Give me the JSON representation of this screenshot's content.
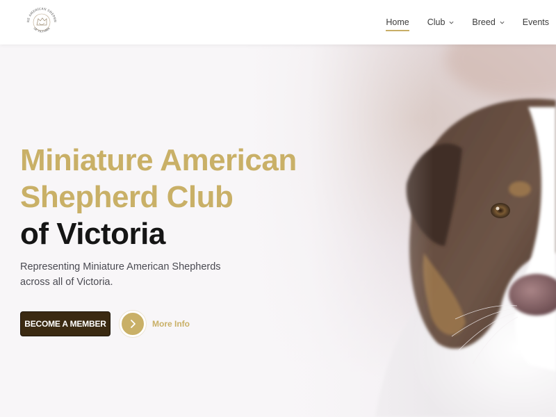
{
  "header": {
    "logo_text_top": "MINIATURE AMERICAN SHEPHERD CLUB",
    "logo_text_bottom": "OF VICTORIA",
    "nav": [
      {
        "label": "Home",
        "active": true,
        "has_dropdown": false
      },
      {
        "label": "Club",
        "active": false,
        "has_dropdown": true
      },
      {
        "label": "Breed",
        "active": false,
        "has_dropdown": true
      },
      {
        "label": "Events",
        "active": false,
        "has_dropdown": false
      }
    ]
  },
  "hero": {
    "title_line1": "Miniature American",
    "title_line2": "Shepherd Club",
    "title_line3": "of Victoria",
    "subtitle": "Representing Miniature American Shepherds across all of Victoria.",
    "primary_button": "BECOME A MEMBER",
    "secondary_link": "More Info",
    "image": "miniature-american-shepherd-dog-photo"
  },
  "colors": {
    "accent_gold": "#c9b067",
    "button_dark": "#3b2a12",
    "title_dark": "#151515"
  }
}
